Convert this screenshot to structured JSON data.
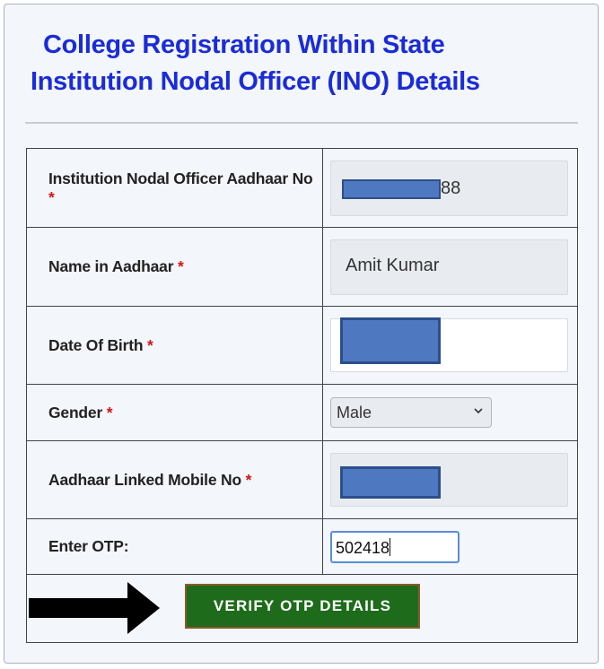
{
  "header": {
    "title_line1": "College Registration Within State",
    "title_line2": "Institution Nodal Officer (INO) Details"
  },
  "form": {
    "required_mark": "*",
    "rows": [
      {
        "label": "Institution Nodal Officer Aadhaar No",
        "required": true,
        "value_suffix": "88",
        "redacted": true
      },
      {
        "label": "Name in Aadhaar",
        "required": true,
        "value": "Amit Kumar"
      },
      {
        "label": "Date Of Birth",
        "required": true,
        "redacted": true
      },
      {
        "label": "Gender",
        "required": true,
        "selected": "Male"
      },
      {
        "label": "Aadhaar Linked Mobile No",
        "required": true,
        "redacted": true
      },
      {
        "label": "Enter OTP:",
        "required": false,
        "value": "502418"
      }
    ],
    "submit_label": "VERIFY OTP DETAILS"
  },
  "icons": {
    "dropdown": "chevron-down-icon",
    "pointer": "arrow-right-icon"
  },
  "colors": {
    "title": "#1a2cd8",
    "required": "#d1141b",
    "button": "#1e6c1b",
    "redaction": "#4e79c0"
  }
}
